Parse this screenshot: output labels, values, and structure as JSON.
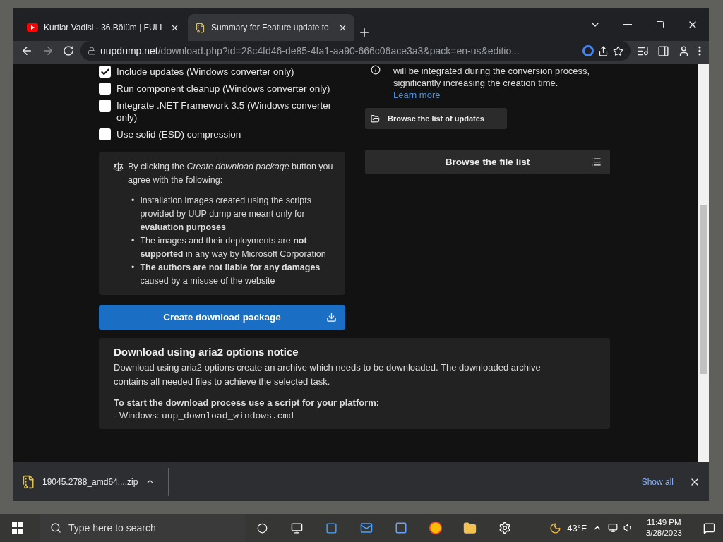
{
  "browser": {
    "tabs": [
      {
        "title": "Kurtlar Vadisi - 36.Bölüm | FULL",
        "kind": "video",
        "selected": false
      },
      {
        "title": "Summary for Feature update to",
        "kind": "page",
        "selected": true
      }
    ],
    "url_host": "uupdump.net",
    "url_path": "/download.php?id=28c4fd46-de85-4fa1-aa90-666c06ace3a3&pack=en-us&editio..."
  },
  "options": [
    {
      "label": "Include updates (Windows converter only)",
      "checked": true
    },
    {
      "label": "Run component cleanup (Windows converter only)",
      "checked": false
    },
    {
      "label": "Integrate .NET Framework 3.5 (Windows converter only)",
      "checked": false
    },
    {
      "label": "Use solid (ESD) compression",
      "checked": false
    }
  ],
  "agreement": {
    "intro": "By clicking the *Create download package* button you agree with the following:",
    "bullet": "•",
    "points": [
      "Installation images created using the scripts provided by UUP dump are meant only for **evaluation purposes**",
      "The images and their deployments are **not supported** in any way by Microsoft Corporation",
      "**The authors are not liable for any damages** caused by a misuse of the website"
    ]
  },
  "create_button": "Create download package",
  "info": {
    "text": "will be integrated during the conversion process, significantly increasing the creation time.",
    "link": "Learn more"
  },
  "updates_button": "Browse the list of updates",
  "file_list_button": "Browse the file list",
  "notice": {
    "title": "Download using aria2 options notice",
    "body": "Download using aria2 options create an archive which needs to be downloaded. The downloaded archive contains all needed files to achieve the selected task.",
    "subtitle": "To start the download process use a script for your platform:",
    "line": "- Windows: ",
    "code": "uup_download_windows.cmd"
  },
  "download_bar": {
    "file": "19045.2788_amd64....zip",
    "show_all": "Show all"
  },
  "taskbar": {
    "search_placeholder": "Type here to search",
    "weather": "43°F",
    "time": "11:49 PM",
    "date": "3/28/2023"
  }
}
